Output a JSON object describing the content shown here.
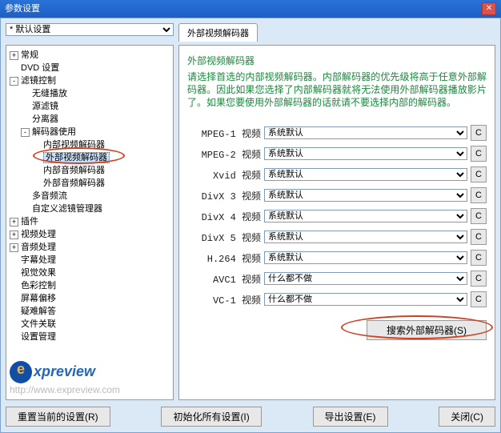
{
  "title": "参数设置",
  "preset": {
    "value": "* 默认设置"
  },
  "tab": {
    "label": "外部视频解码器"
  },
  "tree": {
    "items": [
      {
        "exp": "+",
        "label": "常规",
        "indent": 0
      },
      {
        "exp": "",
        "label": "DVD 设置",
        "indent": 0
      },
      {
        "exp": "-",
        "label": "滤镜控制",
        "indent": 0
      },
      {
        "exp": "",
        "label": "无缝播放",
        "indent": 1
      },
      {
        "exp": "",
        "label": "源滤镜",
        "indent": 1
      },
      {
        "exp": "",
        "label": "分离器",
        "indent": 1
      },
      {
        "exp": "-",
        "label": "解码器使用",
        "indent": 1
      },
      {
        "exp": "",
        "label": "内部视频解码器",
        "indent": 2
      },
      {
        "exp": "",
        "label": "外部视频解码器",
        "indent": 2,
        "selected": true
      },
      {
        "exp": "",
        "label": "内部音频解码器",
        "indent": 2
      },
      {
        "exp": "",
        "label": "外部音频解码器",
        "indent": 2
      },
      {
        "exp": "",
        "label": "多音频流",
        "indent": 1
      },
      {
        "exp": "",
        "label": "自定义滤镜管理器",
        "indent": 1
      },
      {
        "exp": "+",
        "label": "插件",
        "indent": 0
      },
      {
        "exp": "+",
        "label": "视频处理",
        "indent": 0
      },
      {
        "exp": "+",
        "label": "音频处理",
        "indent": 0
      },
      {
        "exp": "",
        "label": "字幕处理",
        "indent": 0
      },
      {
        "exp": "",
        "label": "视觉效果",
        "indent": 0
      },
      {
        "exp": "",
        "label": "色彩控制",
        "indent": 0
      },
      {
        "exp": "",
        "label": "屏幕偏移",
        "indent": 0
      },
      {
        "exp": "",
        "label": "疑难解答",
        "indent": 0
      },
      {
        "exp": "",
        "label": "文件关联",
        "indent": 0
      },
      {
        "exp": "",
        "label": "设置管理",
        "indent": 0
      }
    ]
  },
  "panel": {
    "heading": "外部视频解码器",
    "help": "请选择首选的内部视频解码器。内部解码器的优先级将高于任意外部解码器。因此如果您选择了内部解码器就将无法使用外部解码器播放影片了。如果您要使用外部解码器的话就请不要选择内部的解码器。",
    "decoders": [
      {
        "label": "MPEG-1 视频",
        "value": "系统默认"
      },
      {
        "label": "MPEG-2 视频",
        "value": "系统默认"
      },
      {
        "label": "Xvid 视频",
        "value": "系统默认"
      },
      {
        "label": "DivX 3 视频",
        "value": "系统默认"
      },
      {
        "label": "DivX 4 视频",
        "value": "系统默认"
      },
      {
        "label": "DivX 5 视频",
        "value": "系统默认"
      },
      {
        "label": "H.264 视频",
        "value": "系统默认"
      },
      {
        "label": "AVC1 视频",
        "value": "什么都不做"
      },
      {
        "label": "VC-1 视频",
        "value": "什么都不做"
      }
    ],
    "cbutton": "C",
    "searchButton": "搜索外部解码器(S)"
  },
  "watermark": {
    "brand": "xpreview",
    "url": "http://www.expreview.com"
  },
  "buttons": {
    "reset": "重置当前的设置(R)",
    "init": "初始化所有设置(I)",
    "export": "导出设置(E)",
    "close": "关闭(C)"
  }
}
